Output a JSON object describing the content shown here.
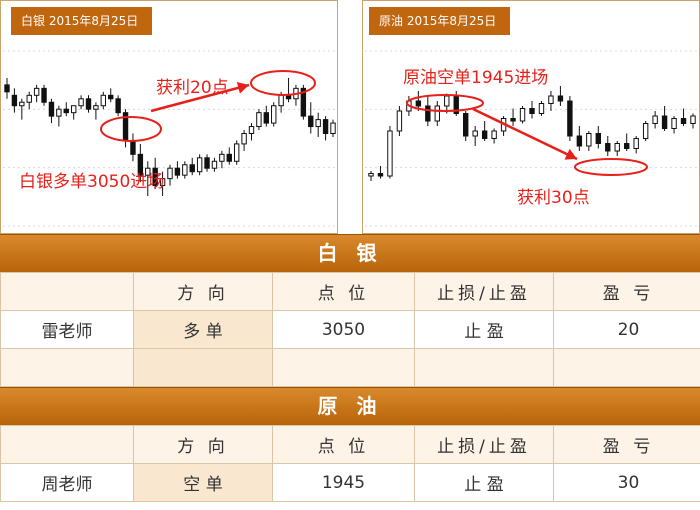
{
  "charts": {
    "silver": {
      "tag": "白银 2015年8月25日",
      "entry_label": "白银多单3050进场",
      "profit_label": "获利20点"
    },
    "oil": {
      "tag": "原油 2015年8月25日",
      "entry_label": "原油空单1945进场",
      "profit_label": "获利30点"
    }
  },
  "tables": [
    {
      "title": "白 银",
      "headers": [
        "",
        "方 向",
        "点 位",
        "止损/止盈",
        "盈 亏"
      ],
      "rows": [
        {
          "teacher": "雷老师",
          "direction": "多 单",
          "price": "3050",
          "stop": "止 盈",
          "pl": "20"
        },
        {
          "teacher": "",
          "direction": "",
          "price": "",
          "stop": "",
          "pl": ""
        }
      ]
    },
    {
      "title": "原 油",
      "headers": [
        "",
        "方 向",
        "点 位",
        "止损/止盈",
        "盈 亏"
      ],
      "rows": [
        {
          "teacher": "周老师",
          "direction": "空 单",
          "price": "1945",
          "stop": "止 盈",
          "pl": "30"
        }
      ]
    }
  ],
  "colors": {
    "accent": "#c0660f",
    "annotation": "#e8201a",
    "header_bg": "#fdf3e6",
    "direction_bg": "#fae7cf"
  },
  "chart_data": [
    {
      "type": "candlestick",
      "title": "白银 2015年8月25日",
      "annotations": [
        "白银多单3050进场",
        "获利20点"
      ],
      "series": [
        {
          "values": [
            [
              58,
              60,
              54,
              56
            ],
            [
              55,
              57,
              50,
              52
            ],
            [
              52,
              54,
              48,
              53
            ],
            [
              53,
              56,
              51,
              55
            ],
            [
              55,
              58,
              53,
              57
            ],
            [
              57,
              58,
              52,
              53
            ],
            [
              53,
              54,
              47,
              49
            ],
            [
              49,
              52,
              46,
              51
            ],
            [
              51,
              53,
              49,
              50
            ],
            [
              50,
              52,
              48,
              52
            ],
            [
              52,
              55,
              51,
              54
            ],
            [
              54,
              55,
              50,
              51
            ],
            [
              51,
              53,
              48,
              52
            ],
            [
              52,
              56,
              51,
              55
            ],
            [
              55,
              57,
              53,
              54
            ],
            [
              54,
              55,
              49,
              50
            ],
            [
              50,
              51,
              40,
              42
            ],
            [
              42,
              44,
              36,
              38
            ],
            [
              38,
              41,
              30,
              32
            ],
            [
              32,
              36,
              26,
              34
            ],
            [
              34,
              37,
              28,
              29
            ],
            [
              29,
              33,
              26,
              31
            ],
            [
              31,
              35,
              29,
              34
            ],
            [
              34,
              36,
              31,
              32
            ],
            [
              32,
              36,
              31,
              35
            ],
            [
              35,
              37,
              32,
              33
            ],
            [
              33,
              38,
              32,
              37
            ],
            [
              37,
              38,
              33,
              34
            ],
            [
              34,
              37,
              33,
              36
            ],
            [
              36,
              39,
              34,
              38
            ],
            [
              38,
              40,
              35,
              36
            ],
            [
              36,
              42,
              35,
              41
            ],
            [
              41,
              45,
              39,
              44
            ],
            [
              44,
              47,
              42,
              46
            ],
            [
              46,
              51,
              45,
              50
            ],
            [
              50,
              52,
              46,
              47
            ],
            [
              47,
              53,
              46,
              52
            ],
            [
              52,
              56,
              50,
              55
            ],
            [
              55,
              60,
              53,
              54
            ],
            [
              54,
              58,
              52,
              57
            ],
            [
              57,
              58,
              48,
              49
            ],
            [
              49,
              53,
              44,
              46
            ],
            [
              46,
              50,
              43,
              48
            ],
            [
              48,
              49,
              42,
              44
            ],
            [
              44,
              48,
              43,
              47
            ]
          ]
        }
      ]
    },
    {
      "type": "candlestick",
      "title": "原油 2015年8月25日",
      "annotations": [
        "原油空单1945进场",
        "获利30点"
      ],
      "series": [
        {
          "values": [
            [
              30,
              32,
              28,
              31
            ],
            [
              31,
              34,
              29,
              30
            ],
            [
              30,
              50,
              29,
              48
            ],
            [
              48,
              58,
              46,
              56
            ],
            [
              56,
              62,
              54,
              60
            ],
            [
              60,
              64,
              56,
              58
            ],
            [
              58,
              62,
              50,
              52
            ],
            [
              52,
              60,
              50,
              58
            ],
            [
              58,
              63,
              55,
              62
            ],
            [
              62,
              64,
              54,
              55
            ],
            [
              55,
              56,
              44,
              46
            ],
            [
              46,
              50,
              42,
              48
            ],
            [
              48,
              52,
              44,
              45
            ],
            [
              45,
              49,
              43,
              48
            ],
            [
              48,
              54,
              46,
              53
            ],
            [
              53,
              57,
              50,
              52
            ],
            [
              52,
              58,
              51,
              57
            ],
            [
              57,
              60,
              53,
              55
            ],
            [
              55,
              60,
              54,
              59
            ],
            [
              59,
              64,
              56,
              62
            ],
            [
              62,
              66,
              58,
              60
            ],
            [
              60,
              62,
              44,
              46
            ],
            [
              46,
              50,
              40,
              42
            ],
            [
              42,
              48,
              40,
              47
            ],
            [
              47,
              50,
              41,
              43
            ],
            [
              43,
              46,
              38,
              40
            ],
            [
              40,
              44,
              38,
              43
            ],
            [
              43,
              47,
              40,
              41
            ],
            [
              41,
              46,
              39,
              45
            ],
            [
              45,
              52,
              44,
              51
            ],
            [
              51,
              56,
              49,
              54
            ],
            [
              54,
              58,
              48,
              49
            ],
            [
              49,
              54,
              47,
              53
            ],
            [
              53,
              57,
              50,
              51
            ],
            [
              51,
              55,
              49,
              54
            ]
          ]
        }
      ]
    }
  ]
}
